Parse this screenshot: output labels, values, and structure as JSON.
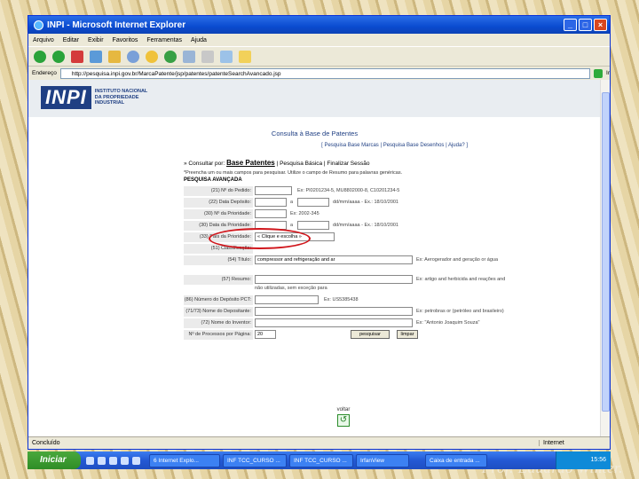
{
  "window": {
    "title": "INPI - Microsoft Internet Explorer"
  },
  "menu": [
    "Arquivo",
    "Editar",
    "Exibir",
    "Favoritos",
    "Ferramentas",
    "Ajuda"
  ],
  "address": {
    "label": "Endereço",
    "url": "http://pesquisa.inpi.gov.br/MarcaPatente/jsp/patentes/patenteSearchAvancado.jsp",
    "go": "Ir"
  },
  "logo": {
    "big": "INPI",
    "small": "INSTITUTO NACIONAL DA PROPRIEDADE INDUSTRIAL"
  },
  "page": {
    "title": "Consulta à Base de Patentes",
    "links": "[ Pesquisa Base Marcas | Pesquisa Base Desenhos | Ajuda? ]",
    "breadcrumb_prefix": "» Consultar por:",
    "breadcrumb_main": "Base Patentes",
    "breadcrumb_rest": "| Pesquisa Básica | Finalizar Sessão",
    "note": "*Preencha um ou mais campos para pesquisar. Utilize o campo de Resumo para palavras genéricas.",
    "form_title": "PESQUISA AVANÇADA"
  },
  "form": {
    "numero_pedido": {
      "label": "(21) Nº do Pedido:",
      "hint": "Ex: PI0201234-5, MU8802000-8, C10201234-5"
    },
    "data_deposito": {
      "label": "(22) Data Depósito:",
      "between": "a",
      "hint": "dd/mm/aaaa - Ex.: 18/10/2001"
    },
    "numero_prioridade": {
      "label": "(30) Nº da Prioridade:",
      "hint": "Ex: 2002-345"
    },
    "data_prioridade": {
      "label": "(30) Data da Prioridade:",
      "between": "a",
      "hint": "dd/mm/aaaa - Ex.: 18/10/2001"
    },
    "pais_prioridade": {
      "label": "(33) País da Prioridade:",
      "value": "« Clique e escolha »"
    },
    "classificacao": {
      "label": "(51) Classificação:"
    },
    "titulo": {
      "label": "(54) Título:",
      "value": "compressor and refrigeração and ar",
      "hint": "Ex: Aerogerador and geração or água"
    },
    "resumo": {
      "label": "(57) Resumo:",
      "hint": "Ex: artigo and herbicida and reações and",
      "hint2": "não utilizadas, sem exceção para"
    },
    "numero_depositante": {
      "label": "(86) Número do Depósito PCT:",
      "hint": "Ex: US5385438"
    },
    "depositante": {
      "label": "(71/73) Nome do Depositante:",
      "hint": "Ex: petrobras or (petróleo and brasileiro)"
    },
    "inventor": {
      "label": "(72) Nome do Inventor:",
      "hint": "Ex: \"Antonio Joaquim Souza\""
    },
    "processos": {
      "label": "Nº de Processos por Página:",
      "value": "20"
    },
    "pesquisar": "pesquisar",
    "limpar": "limpar"
  },
  "voltar": "voltar",
  "status": {
    "text": "Concluído",
    "zone": "Internet"
  },
  "taskbar": {
    "start": "Iniciar",
    "tasks": [
      "6 Internet Explo...",
      "INF TCC_CURSO ...",
      "INF TCC_CURSO ...",
      "IrfanView",
      "Caixa de entrada ..."
    ],
    "clock": "15:56"
  },
  "signature": "Prof. Eduardo Winter."
}
